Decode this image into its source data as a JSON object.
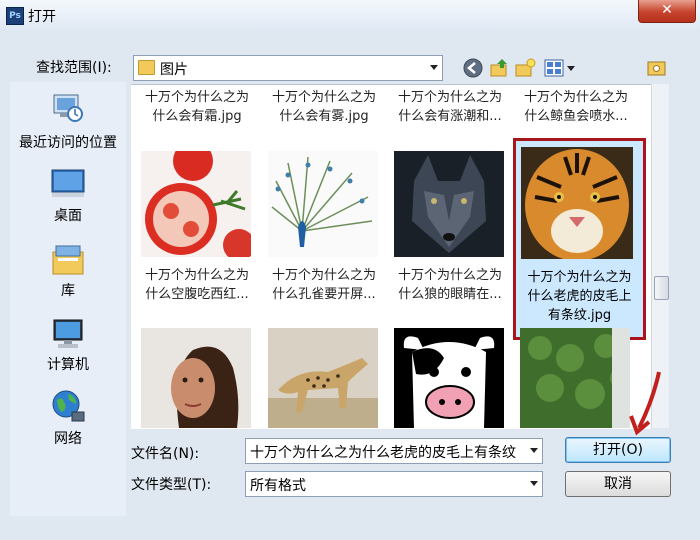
{
  "window": {
    "title": "打开",
    "close_glyph": "✕",
    "app_icon": "Ps"
  },
  "lookin": {
    "label": "查找范围(I):",
    "value": "图片"
  },
  "toolbar": {
    "icons": [
      "back-icon",
      "up-folder-icon",
      "new-folder-icon",
      "views-menu-icon",
      "preview-icon"
    ]
  },
  "places": [
    {
      "label": "最近访问的位置",
      "icon": "recent-places-icon"
    },
    {
      "label": "桌面",
      "icon": "desktop-icon"
    },
    {
      "label": "库",
      "icon": "libraries-icon"
    },
    {
      "label": "计算机",
      "icon": "computer-icon"
    },
    {
      "label": "网络",
      "icon": "network-icon"
    }
  ],
  "files_row1": [
    {
      "line1": "十万个为什么之为",
      "line2": "什么会有霜.jpg"
    },
    {
      "line1": "十万个为什么之为",
      "line2": "什么会有雾.jpg"
    },
    {
      "line1": "十万个为什么之为",
      "line2": "什么会有涨潮和..."
    },
    {
      "line1": "十万个为什么之为",
      "line2": "什么鲸鱼会喷水..."
    }
  ],
  "files_row2": [
    {
      "line1": "十万个为什么之为",
      "line2": "什么空腹吃西红...",
      "thumb": "tomato"
    },
    {
      "line1": "十万个为什么之为",
      "line2": "什么孔雀要开屏...",
      "thumb": "peacock"
    },
    {
      "line1": "十万个为什么之为",
      "line2": "什么狼的眼睛在...",
      "thumb": "wolf"
    },
    {
      "line1": "十万个为什么之为",
      "line2": "什么老虎的皮毛上",
      "line3": "有条纹.jpg",
      "thumb": "tiger",
      "selected": true
    }
  ],
  "files_row3": [
    {
      "thumb": "woman"
    },
    {
      "thumb": "cheetah"
    },
    {
      "thumb": "cow"
    },
    {
      "thumb": "green-wall"
    }
  ],
  "filename": {
    "label": "文件名(N):",
    "value": "十万个为什么之为什么老虎的皮毛上有条纹"
  },
  "filetype": {
    "label": "文件类型(T):",
    "value": "所有格式"
  },
  "buttons": {
    "open": "打开(O)",
    "cancel": "取消"
  }
}
